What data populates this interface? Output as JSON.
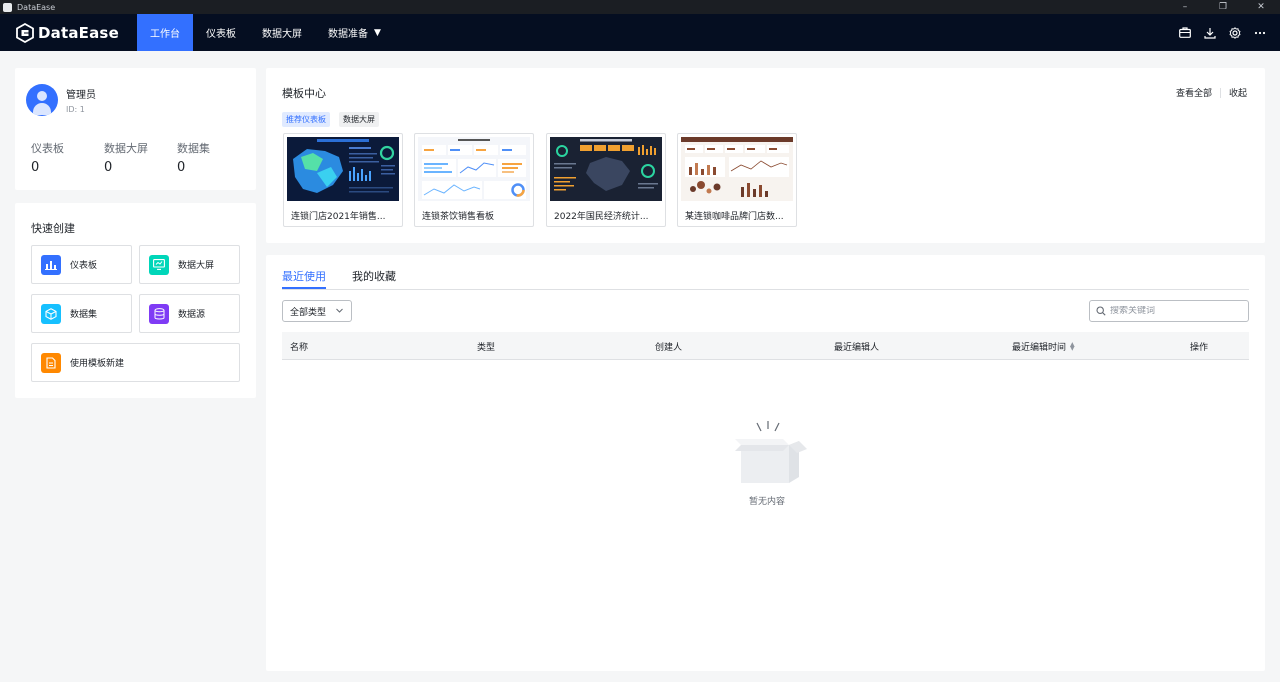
{
  "window": {
    "title": "DataEase"
  },
  "brand": {
    "name": "DataEase",
    "accent": "#3370ff",
    "nav_bg": "#050e21"
  },
  "nav": {
    "items": [
      {
        "label": "工作台",
        "active": true
      },
      {
        "label": "仪表板",
        "active": false
      },
      {
        "label": "数据大屏",
        "active": false
      },
      {
        "label": "数据准备",
        "active": false,
        "dropdown": true
      }
    ],
    "right_icons": [
      "briefcase-icon",
      "download-icon",
      "settings-icon",
      "more-icon"
    ]
  },
  "user": {
    "name": "管理员",
    "id_text": "ID: 1",
    "stats": [
      {
        "label": "仪表板",
        "value": "0"
      },
      {
        "label": "数据大屏",
        "value": "0"
      },
      {
        "label": "数据集",
        "value": "0"
      }
    ]
  },
  "quick_create": {
    "title": "快速创建",
    "items": [
      {
        "label": "仪表板",
        "icon": "bar-chart-icon",
        "color": "#3370ff"
      },
      {
        "label": "数据大屏",
        "icon": "screen-icon",
        "color": "#00d6b9"
      },
      {
        "label": "数据集",
        "icon": "cube-icon",
        "color": "#16c0ff"
      },
      {
        "label": "数据源",
        "icon": "database-icon",
        "color": "#7f3bf5"
      },
      {
        "label": "使用模板新建",
        "icon": "template-icon",
        "color": "#ff8800"
      }
    ]
  },
  "template_center": {
    "title": "模板中心",
    "view_all": "查看全部",
    "collapse": "收起",
    "tabs": [
      {
        "label": "推荐仪表板",
        "active": true
      },
      {
        "label": "数据大屏",
        "active": false
      }
    ],
    "templates": [
      {
        "name": "连锁门店2021年销售..."
      },
      {
        "name": "连锁茶饮销售看板"
      },
      {
        "name": "2022年国民经济统计..."
      },
      {
        "name": "某连锁咖啡品牌门店数..."
      }
    ]
  },
  "recent": {
    "tabs": [
      {
        "label": "最近使用",
        "active": true
      },
      {
        "label": "我的收藏",
        "active": false
      }
    ],
    "type_filter": "全部类型",
    "search_placeholder": "搜索关键词",
    "columns": [
      "名称",
      "类型",
      "创建人",
      "最近编辑人",
      "最近编辑时间",
      "操作"
    ],
    "rows": [],
    "empty_text": "暂无内容"
  }
}
